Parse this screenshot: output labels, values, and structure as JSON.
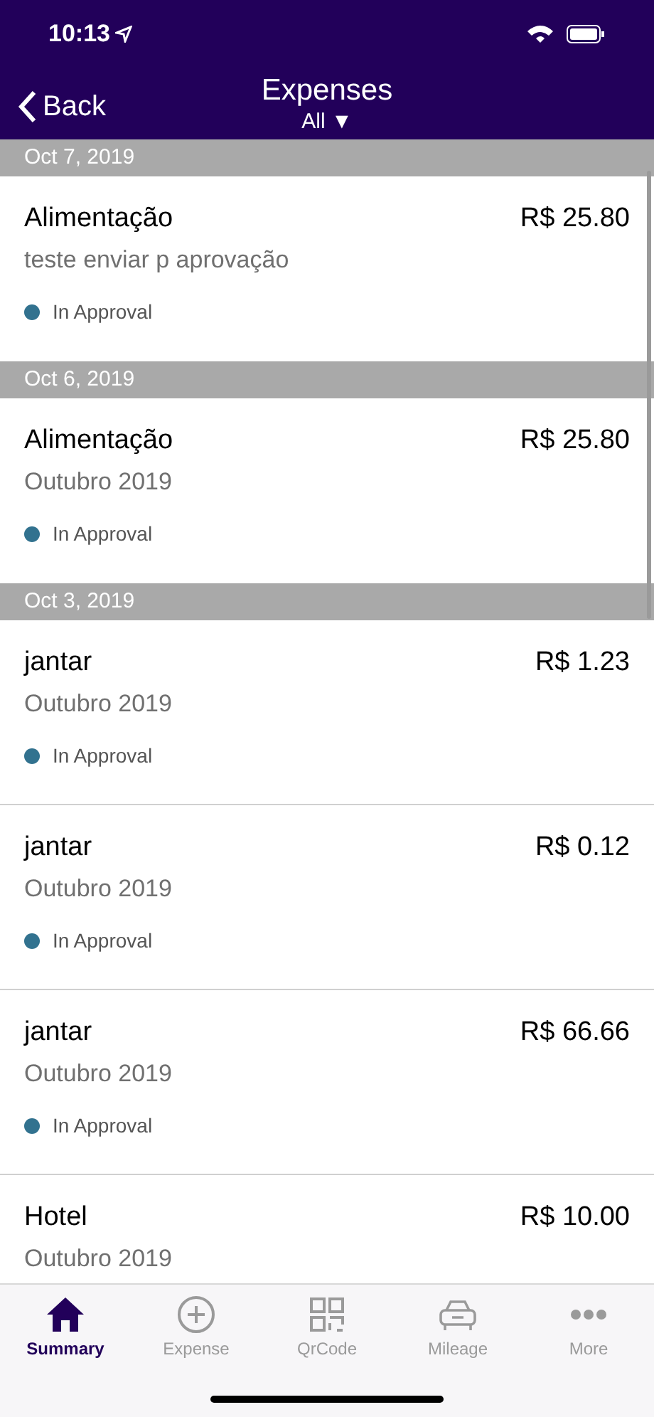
{
  "status_bar": {
    "time": "10:13"
  },
  "nav": {
    "back": "Back",
    "title": "Expenses",
    "filter": "All ▼"
  },
  "sections": [
    {
      "date": "Oct 7, 2019",
      "items": [
        {
          "title": "Alimentação",
          "amount": "R$ 25.80",
          "subtitle": "teste enviar p aprovação",
          "status": "In Approval",
          "color": "#32728f"
        }
      ]
    },
    {
      "date": "Oct 6, 2019",
      "items": [
        {
          "title": "Alimentação",
          "amount": "R$ 25.80",
          "subtitle": "Outubro 2019",
          "status": "In Approval",
          "color": "#32728f"
        }
      ]
    },
    {
      "date": "Oct 3, 2019",
      "items": [
        {
          "title": "jantar",
          "amount": "R$ 1.23",
          "subtitle": "Outubro 2019",
          "status": "In Approval",
          "color": "#32728f"
        },
        {
          "title": "jantar",
          "amount": "R$ 0.12",
          "subtitle": "Outubro 2019",
          "status": "In Approval",
          "color": "#32728f"
        },
        {
          "title": "jantar",
          "amount": "R$ 66.66",
          "subtitle": "Outubro 2019",
          "status": "In Approval",
          "color": "#32728f"
        },
        {
          "title": "Hotel",
          "amount": "R$ 10.00",
          "subtitle": "Outubro 2019"
        }
      ]
    }
  ],
  "tabs": [
    {
      "label": "Summary",
      "kind": "home",
      "selected": true
    },
    {
      "label": "Expense",
      "kind": "plus",
      "selected": false
    },
    {
      "label": "QrCode",
      "kind": "qr",
      "selected": false
    },
    {
      "label": "Mileage",
      "kind": "car",
      "selected": false
    },
    {
      "label": "More",
      "kind": "more",
      "selected": false
    }
  ]
}
